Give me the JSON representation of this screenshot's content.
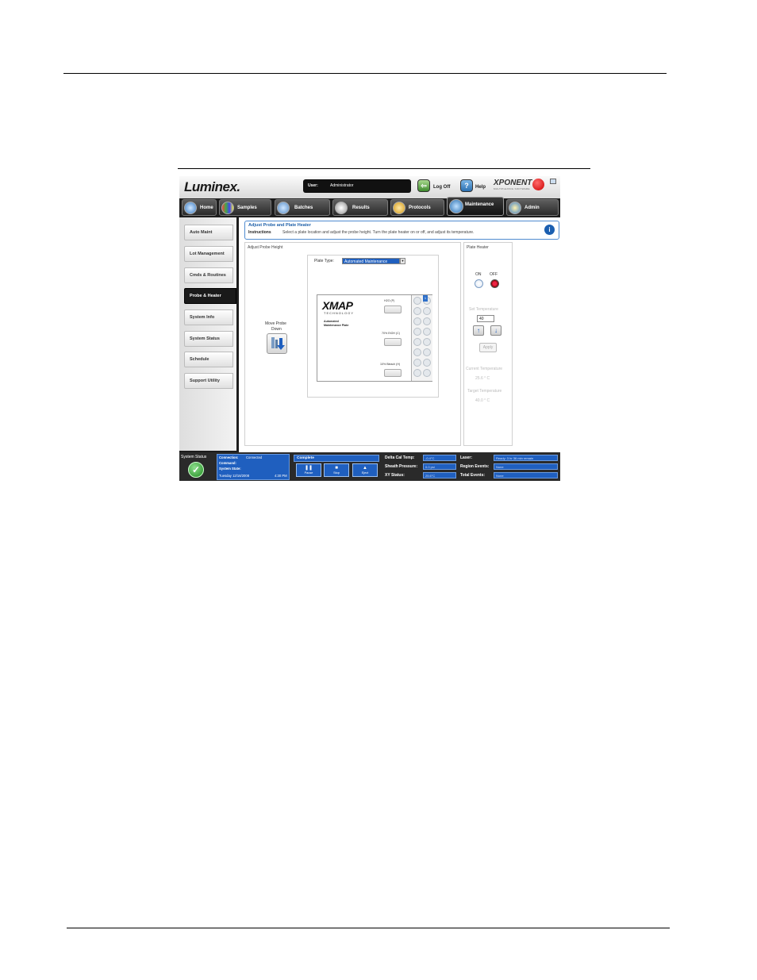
{
  "header": {
    "logo": "Luminex.",
    "user_label": "User:",
    "user_value": "Administrator",
    "logoff_label": "Log Off",
    "help_label": "Help",
    "brand": "XPONENT",
    "brand_sub": "MULTIPLEXING SOFTWARE"
  },
  "tabs": [
    {
      "label": "Home"
    },
    {
      "label": "Samples"
    },
    {
      "label": "Batches"
    },
    {
      "label": "Results"
    },
    {
      "label": "Protocols"
    },
    {
      "label": "Maintenance"
    },
    {
      "label": "Admin"
    }
  ],
  "sidebar": [
    {
      "label": "Auto Maint"
    },
    {
      "label": "Lot Management"
    },
    {
      "label": "Cmds & Routines"
    },
    {
      "label": "Probe & Heater"
    },
    {
      "label": "System Info"
    },
    {
      "label": "System Status"
    },
    {
      "label": "Schedule"
    },
    {
      "label": "Support Utility"
    }
  ],
  "instructions": {
    "title": "Adjust Probe and Plate Heater",
    "label": "Instructions",
    "text": "Select a plate location and adjust the probe height. Turn the plate heater on or off, and adjust its temperature."
  },
  "probe_panel": {
    "title": "Adjust Probe Height",
    "plate_type_label": "Plate Type:",
    "plate_type_value": "Automated Maintenance",
    "move_probe_label_1": "Move Probe",
    "move_probe_label_2": "Down",
    "plate_logo": "XMAP",
    "plate_logo_sub": "TECHNOLOGY",
    "plate_desc_1": "Automated",
    "plate_desc_2": "Maintenance Plate",
    "slot_labels": [
      "H2O (P)",
      "70% EtOH (C)",
      "10% Bleach (H)"
    ],
    "corner_badge": "1"
  },
  "heater_panel": {
    "title": "Plate Heater",
    "on_label": "ON",
    "off_label": "OFF",
    "state": "OFF",
    "set_temp_label": "Set Temperature",
    "set_temp_value": "40",
    "apply_label": "Apply",
    "current_temp_label": "Current Temperature",
    "current_temp_value": "25.6 ° C",
    "target_temp_label": "Target Temperature",
    "target_temp_value": "40.0 ° C"
  },
  "statusbar": {
    "system_status_label": "System Status",
    "connection_label": "Connection:",
    "connection_value": "Connected",
    "command_label": "Command:",
    "system_state_label": "System State:",
    "datetime_value": "Tuesday 12/16/2008",
    "time_value": "4:30 PM",
    "progress_label": "Complete",
    "pause_label": "Pause",
    "stop_label": "Stop",
    "eject_label": "Eject",
    "delta_cal_label": "Delta Cal Temp:",
    "delta_cal_value": "-0.4°C",
    "sheath_label": "Sheath Pressure:",
    "sheath_value": "0.0 psi",
    "xy_label": "XY Status:",
    "xy_value": "25.6°C",
    "laser_label": "Laser:",
    "laser_value": "Ready: 3 hr 36 min remain",
    "region_label": "Region Events:",
    "region_value": "None",
    "total_label": "Total Events:",
    "total_value": "None"
  }
}
